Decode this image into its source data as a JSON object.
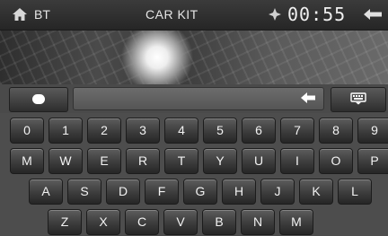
{
  "top_bar": {
    "section": "BT",
    "title": "CAR KIT",
    "time": "00:55"
  },
  "icons": {
    "home": "home-icon",
    "clock": "clock-icon",
    "back": "back-arrow-icon",
    "message": "message-icon",
    "backspace": "backspace-icon",
    "keyboard": "keyboard-icon"
  },
  "input": {
    "value": ""
  },
  "keyboard": {
    "rows": [
      [
        "0",
        "1",
        "2",
        "3",
        "4",
        "5",
        "6",
        "7",
        "8",
        "9"
      ],
      [
        "M",
        "W",
        "E",
        "R",
        "T",
        "Y",
        "U",
        "I",
        "O",
        "P"
      ],
      [
        "A",
        "S",
        "D",
        "F",
        "G",
        "H",
        "J",
        "K",
        "L"
      ],
      [
        "Z",
        "X",
        "C",
        "V",
        "B",
        "N",
        "M"
      ]
    ]
  },
  "colors": {
    "bar": "#2e2e2e",
    "key": "#3c3c3c",
    "text": "#f2f2f2"
  }
}
